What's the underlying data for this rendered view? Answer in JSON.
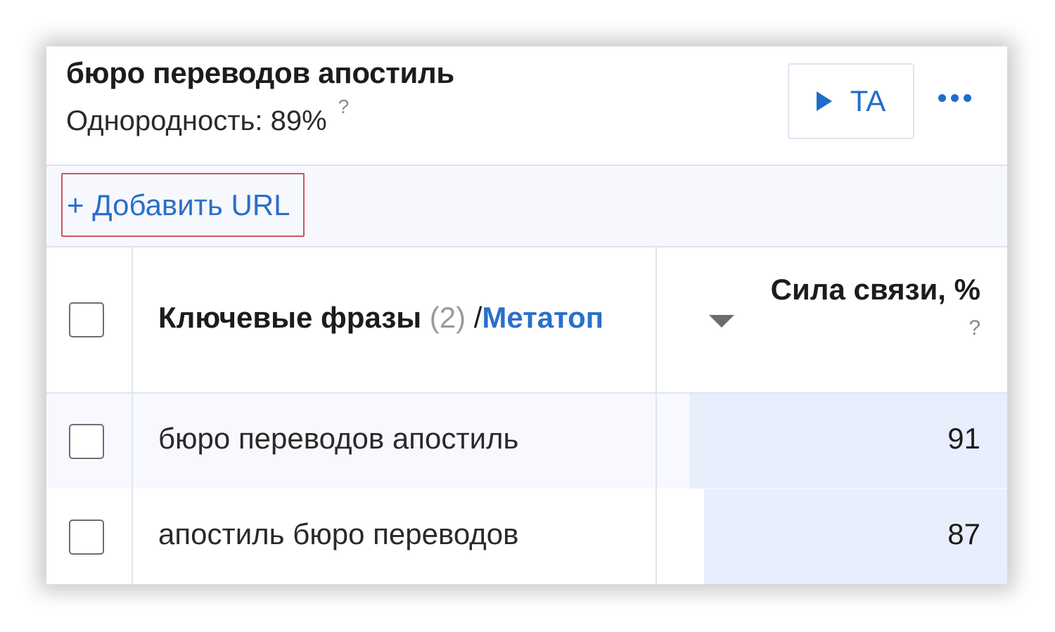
{
  "header": {
    "title": "бюро переводов апостиль",
    "homogeneity": "Однородность: 89%",
    "homogeneity_help": "?",
    "ta_button_label": "TA"
  },
  "toolbar": {
    "add_url_label": "+ Добавить URL"
  },
  "table": {
    "columns": {
      "phrases_label": "Ключевые фразы",
      "phrases_count": "(2)",
      "phrases_separator": "/",
      "metatop_label": "Метатоп",
      "strength_label": "Сила связи, %",
      "strength_help": "?"
    },
    "rows": [
      {
        "phrase": "бюро переводов апостиль",
        "strength": "91",
        "strength_fraction": 0.91
      },
      {
        "phrase": "апостиль бюро переводов",
        "strength": "87",
        "strength_fraction": 0.87
      }
    ]
  },
  "colors": {
    "accent": "#1f6cc9",
    "highlight_border": "#c9575f",
    "bar_fill": "#e8eefc"
  }
}
